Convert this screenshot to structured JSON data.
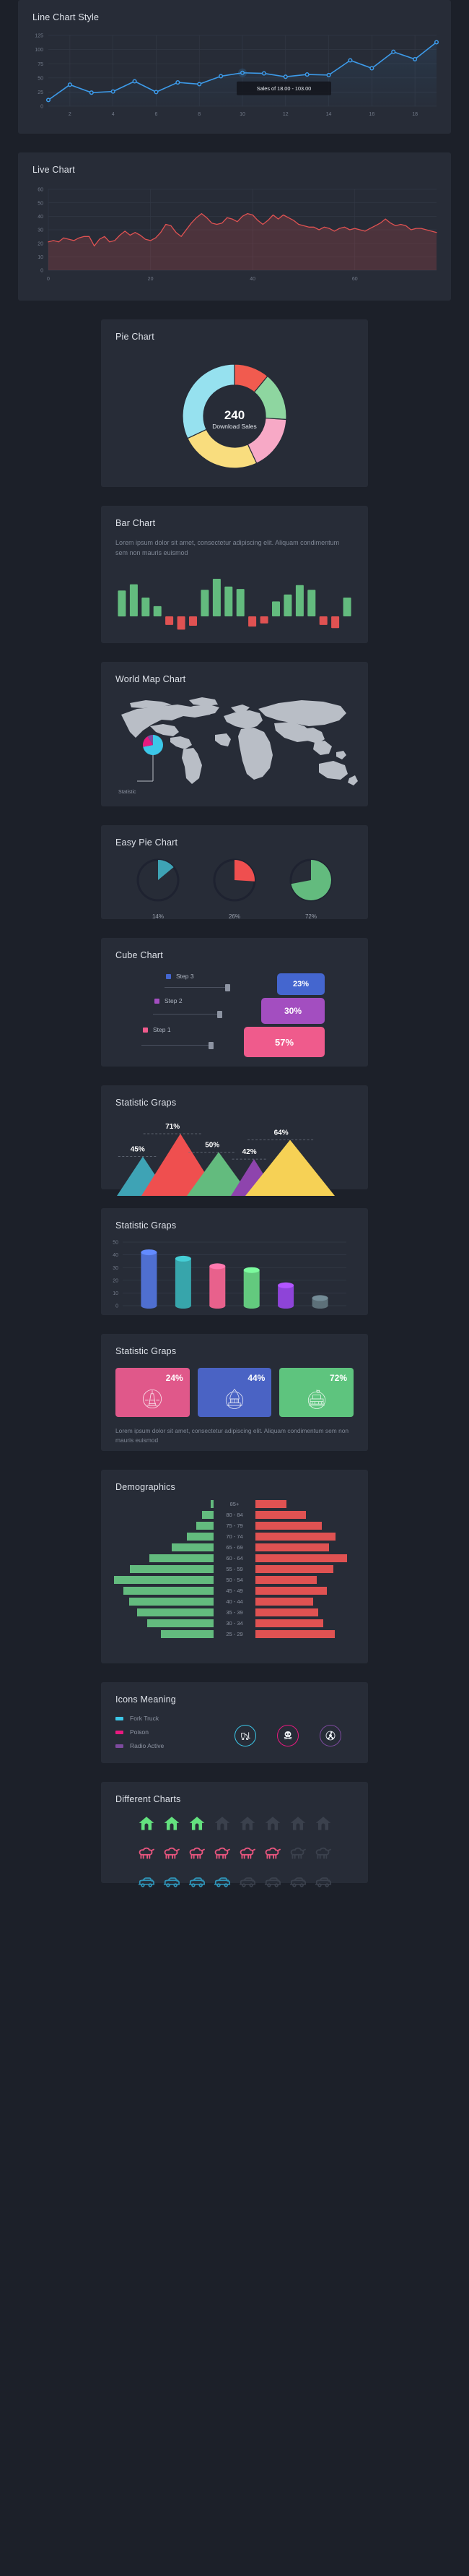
{
  "cards": {
    "line": {
      "title": "Line Chart Style"
    },
    "live": {
      "title": "Live Chart"
    },
    "pie": {
      "title": "Pie Chart",
      "center_value": "240",
      "center_label": "Download Sales"
    },
    "bar": {
      "title": "Bar Chart",
      "desc": "Lorem ipsum dolor sit amet, consectetur adipiscing elit. Aliquam condimentum sem non mauris euismod"
    },
    "map": {
      "title": "World Map Chart",
      "note": "Statistic"
    },
    "easypie": {
      "title": "Easy Pie Chart"
    },
    "cube": {
      "title": "Cube Chart"
    },
    "triangles": {
      "title": "Statistic Graps"
    },
    "cylinders": {
      "title": "Statistic Graps"
    },
    "statcards": {
      "title": "Statistic Graps",
      "desc": "Lorem ipsum dolor sit amet, consectetur adipiscing elit. Aliquam condimentum sem non mauris euismod"
    },
    "demographics": {
      "title": "Demographics"
    },
    "icons_meaning": {
      "title": "Icons Meaning"
    },
    "different_charts": {
      "title": "Different Charts"
    }
  },
  "chart_data": [
    {
      "id": "line_chart_style",
      "type": "line",
      "title": "Line Chart Style",
      "xlabel": "",
      "ylabel": "",
      "xlim": [
        1,
        19
      ],
      "ylim": [
        0,
        125
      ],
      "yticks": [
        0,
        25,
        50,
        75,
        100,
        125
      ],
      "xticks": [
        2,
        4,
        6,
        8,
        10,
        12,
        14,
        16,
        18
      ],
      "grid": true,
      "legend": "none",
      "color": "#3d9bea",
      "x": [
        1,
        2,
        3,
        4,
        5,
        6,
        7,
        8,
        9,
        10,
        11,
        12,
        13,
        14,
        15,
        16,
        17,
        18,
        19
      ],
      "values": [
        11,
        38,
        24,
        26,
        44,
        25,
        42,
        39,
        53,
        59,
        58,
        52,
        56,
        55,
        81,
        67,
        96,
        83,
        113
      ],
      "tooltip": "Sales of 18.00 - 103.00"
    },
    {
      "id": "live_chart",
      "type": "area",
      "title": "Live Chart",
      "xlabel": "",
      "ylabel": "",
      "xlim": [
        0,
        76
      ],
      "ylim": [
        0,
        60
      ],
      "yticks": [
        0,
        10,
        20,
        30,
        40,
        50,
        60
      ],
      "xticks": [
        0,
        20,
        40,
        60
      ],
      "grid": true,
      "color": "#e05252",
      "values": [
        21,
        22,
        21,
        24,
        23,
        22,
        24,
        25,
        25,
        18,
        23,
        25,
        21,
        22,
        26,
        29,
        26,
        28,
        26,
        23,
        22,
        24,
        28,
        34,
        33,
        28,
        25,
        30,
        35,
        39,
        42,
        39,
        35,
        34,
        35,
        39,
        38,
        36,
        40,
        42,
        41,
        37,
        34,
        37,
        41,
        38,
        41,
        39,
        37,
        34,
        33,
        32,
        32,
        30,
        32,
        31,
        29,
        31,
        32,
        30,
        31,
        30,
        29,
        31,
        33,
        35,
        38,
        35,
        33,
        34,
        33,
        30,
        31,
        31,
        30,
        29,
        28
      ]
    },
    {
      "id": "pie_chart",
      "type": "pie",
      "title": "Pie Chart",
      "center_value": 240,
      "center_label": "Download Sales",
      "labels": [
        "Red",
        "Green",
        "Pink",
        "Yellow",
        "Cyan"
      ],
      "values": [
        11,
        15,
        17,
        25,
        32
      ],
      "colors": [
        "#f15b4f",
        "#8ed6a0",
        "#f7a9c6",
        "#f9dd7e",
        "#96e1ef"
      ]
    },
    {
      "id": "bar_chart",
      "type": "bar",
      "title": "Bar Chart",
      "positive_color": "#63bb7e",
      "negative_color": "#e05252",
      "values": [
        33,
        41,
        24,
        13,
        -11,
        -17,
        -12,
        34,
        48,
        38,
        35,
        -13,
        -9,
        19,
        28,
        40,
        34,
        -11,
        -15,
        24
      ]
    },
    {
      "id": "world_map_chart",
      "type": "pie",
      "title": "World Map Chart",
      "labels": [
        "Cyan",
        "Magenta",
        "Purple"
      ],
      "values": [
        72,
        19,
        9
      ],
      "colors": [
        "#3cc7e8",
        "#e8197f",
        "#7d4a9e"
      ],
      "annotation": "Statistic"
    },
    {
      "id": "easy_pie_chart",
      "type": "pie",
      "title": "Easy Pie Chart",
      "series": [
        {
          "name": "pie-1",
          "value": 14,
          "label": "14%",
          "color": "#3ea3b5"
        },
        {
          "name": "pie-2",
          "value": 26,
          "label": "26%",
          "color": "#ef4f4f"
        },
        {
          "name": "pie-3",
          "value": 72,
          "label": "72%",
          "color": "#63bb7e"
        }
      ]
    },
    {
      "id": "cube_chart",
      "type": "bar",
      "title": "Cube Chart",
      "categories": [
        "Step 3",
        "Step 2",
        "Step 1"
      ],
      "values": [
        23,
        30,
        57
      ],
      "labels": [
        "23%",
        "30%",
        "57%"
      ],
      "colors": [
        "#4466cf",
        "#a34ec0",
        "#ef5b8c"
      ]
    },
    {
      "id": "statistic_graps_triangles",
      "type": "bar",
      "title": "Statistic Graps",
      "values": [
        45,
        71,
        50,
        42,
        64
      ],
      "labels": [
        "45%",
        "71%",
        "50%",
        "42%",
        "64%"
      ],
      "colors": [
        "#3ea3b5",
        "#ef4f4f",
        "#63bb7e",
        "#8e44ad",
        "#f6d155"
      ]
    },
    {
      "id": "statistic_graps_cylinders",
      "type": "bar",
      "title": "Statistic Graps",
      "ylim": [
        0,
        50
      ],
      "yticks": [
        0,
        10,
        20,
        30,
        40,
        50
      ],
      "grid": true,
      "values": [
        42,
        37,
        31,
        28,
        16,
        6
      ],
      "colors": [
        "#4f6fd0",
        "#37a5ab",
        "#e8618c",
        "#63c97e",
        "#8e44d8",
        "#5d7079"
      ]
    },
    {
      "id": "statistic_graps_cards",
      "type": "bar",
      "title": "Statistic Graps",
      "values": [
        24,
        44,
        72
      ],
      "labels": [
        "24%",
        "44%",
        "72%"
      ],
      "colors": [
        "#e0588a",
        "#4a63c4",
        "#5ec47e"
      ],
      "icons": [
        "eiffel-tower-icon",
        "capitol-icon",
        "castle-icon"
      ]
    },
    {
      "id": "demographics",
      "type": "bar",
      "title": "Demographics",
      "categories": [
        "85+",
        "80 - 84",
        "75 - 79",
        "70 - 74",
        "65 - 69",
        "60 - 64",
        "55 - 59",
        "50 - 54",
        "45 - 49",
        "40 - 44",
        "35 - 39",
        "30 - 34",
        "25 - 29"
      ],
      "series": [
        {
          "name": "left",
          "color": "#63bb7e",
          "values": [
            4,
            14,
            22,
            33,
            52,
            80,
            104,
            124,
            112,
            105,
            95,
            83,
            66
          ]
        },
        {
          "name": "right",
          "color": "#e05252",
          "values": [
            39,
            63,
            83,
            100,
            92,
            114,
            97,
            76,
            89,
            72,
            78,
            84,
            99
          ]
        }
      ]
    },
    {
      "id": "different_charts",
      "type": "bar",
      "title": "Different Charts",
      "series": [
        {
          "name": "house-icon",
          "filled": 3,
          "total": 8,
          "color": "#63e07e"
        },
        {
          "name": "sheep-icon",
          "filled": 6,
          "total": 8,
          "color": "#e8557e"
        },
        {
          "name": "car-icon",
          "filled": 4,
          "total": 8,
          "color": "#2f94b8"
        }
      ],
      "inactive_color": "#3b414d"
    }
  ],
  "cube_chart": {
    "steps": [
      {
        "legend": "Step 3",
        "value": "23%",
        "color": "#4466cf",
        "width": 66
      },
      {
        "legend": "Step 2",
        "value": "30%",
        "color": "#a34ec0",
        "width": 88
      },
      {
        "legend": "Step 1",
        "value": "57%",
        "color": "#ef5b8c",
        "width": 112
      }
    ]
  },
  "icons_meaning": {
    "legend": [
      {
        "label": "Fork Truck",
        "color": "#3cc7e8"
      },
      {
        "label": "Poison",
        "color": "#e8197f"
      },
      {
        "label": "Radio Active",
        "color": "#7d4a9e"
      }
    ],
    "icons": [
      {
        "name": "fork-truck-icon",
        "color": "#3cc7e8"
      },
      {
        "name": "poison-skull-icon",
        "color": "#e8197f"
      },
      {
        "name": "radioactive-icon",
        "color": "#7d4a9e"
      }
    ]
  }
}
